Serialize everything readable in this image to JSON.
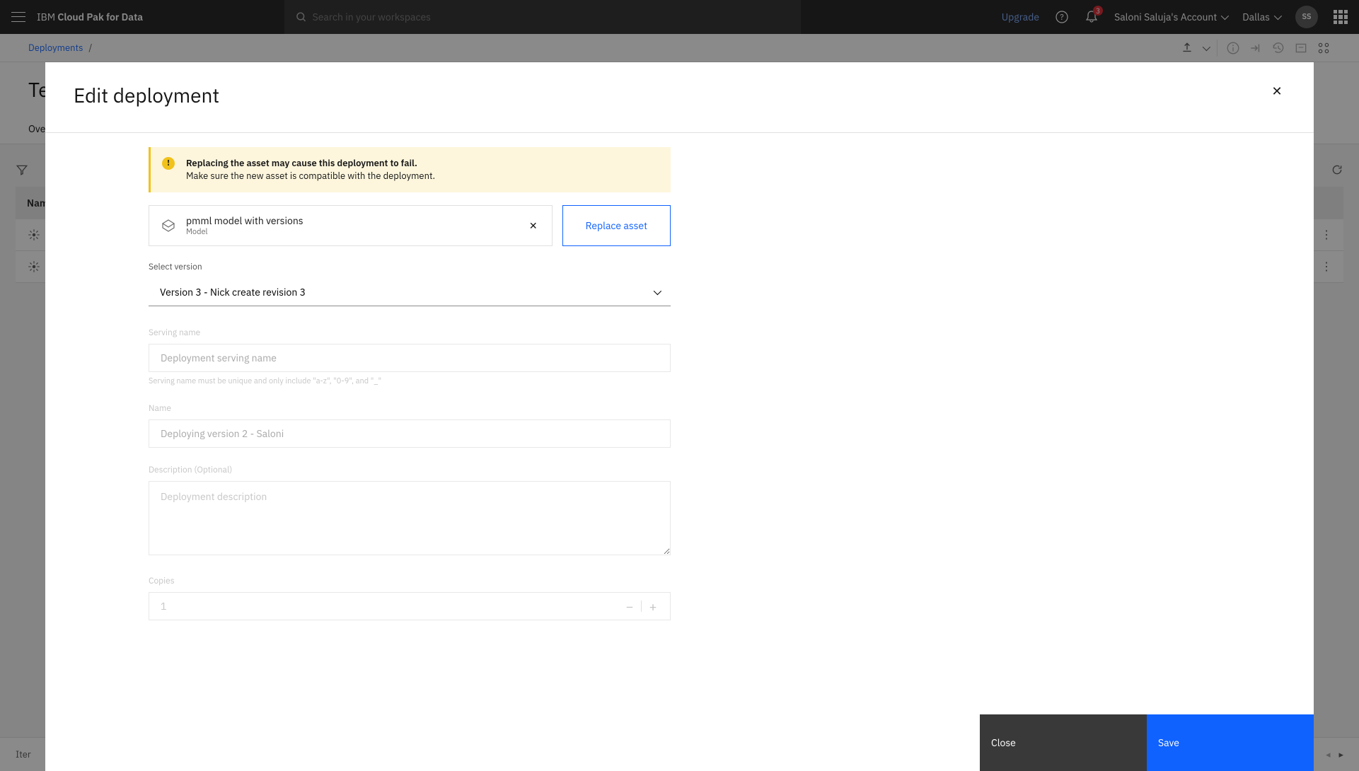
{
  "header": {
    "brand_prefix": "IBM ",
    "brand_bold": "Cloud Pak for Data",
    "search_placeholder": "Search in your workspaces",
    "upgrade": "Upgrade",
    "notif_count": "3",
    "account": "Saloni Saluja's Account",
    "region": "Dallas",
    "avatar": "SS"
  },
  "breadcrumb": {
    "link": "Deployments",
    "sep": "/"
  },
  "page": {
    "title_prefix": "Te",
    "tab": "Ove",
    "col_name": "Name",
    "items_label": "Iter"
  },
  "modal": {
    "title": "Edit deployment",
    "warning_title": "Replacing the asset may cause this deployment to fail.",
    "warning_body": "Make sure the new asset is compatible with the deployment.",
    "asset_name": "pmml model with versions",
    "asset_type": "Model",
    "replace_btn": "Replace asset",
    "version_label": "Select version",
    "version_value": "Version 3 - Nick create revision 3",
    "serving_label": "Serving name",
    "serving_placeholder": "Deployment serving name",
    "serving_helper": "Serving name must be unique and only include \"a-z\", \"0-9\", and \"_\"",
    "name_label": "Name",
    "name_value": "Deploying version 2 - Saloni",
    "desc_label": "Description (Optional)",
    "desc_placeholder": "Deployment description",
    "copies_label": "Copies",
    "copies_value": "1",
    "close_btn": "Close",
    "save_btn": "Save"
  }
}
